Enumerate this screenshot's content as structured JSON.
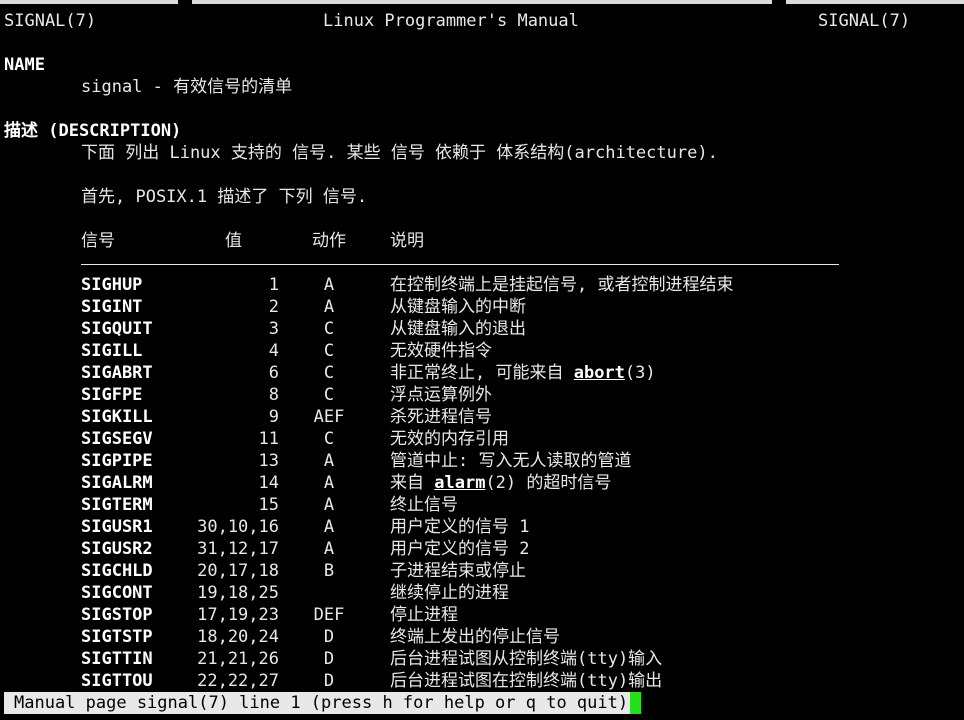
{
  "header": {
    "left": "SIGNAL(7)",
    "center": "Linux Programmer's Manual",
    "right": "SIGNAL(7)"
  },
  "name_section": {
    "heading": "NAME",
    "text": "signal - 有效信号的清单"
  },
  "description_section": {
    "heading": "描述 (DESCRIPTION)",
    "para1": "下面 列出 Linux 支持的 信号. 某些 信号 依赖于 体系结构(architecture).",
    "para2": "首先, POSIX.1 描述了 下列 信号."
  },
  "table": {
    "headers": [
      "信号",
      "值",
      "动作",
      "说明"
    ],
    "rows": [
      {
        "signal": "SIGHUP",
        "value": "1",
        "action": "A",
        "desc": "在控制终端上是挂起信号, 或者控制进程结束"
      },
      {
        "signal": "SIGINT",
        "value": "2",
        "action": "A",
        "desc": "从键盘输入的中断"
      },
      {
        "signal": "SIGQUIT",
        "value": "3",
        "action": "C",
        "desc": "从键盘输入的退出"
      },
      {
        "signal": "SIGILL",
        "value": "4",
        "action": "C",
        "desc": "无效硬件指令"
      },
      {
        "signal": "SIGABRT",
        "value": "6",
        "action": "C",
        "desc": "非正常终止, 可能来自 ",
        "link": "abort",
        "suffix": "(3)"
      },
      {
        "signal": "SIGFPE",
        "value": "8",
        "action": "C",
        "desc": "浮点运算例外"
      },
      {
        "signal": "SIGKILL",
        "value": "9",
        "action": "AEF",
        "desc": "杀死进程信号"
      },
      {
        "signal": "SIGSEGV",
        "value": "11",
        "action": "C",
        "desc": "无效的内存引用"
      },
      {
        "signal": "SIGPIPE",
        "value": "13",
        "action": "A",
        "desc": "管道中止: 写入无人读取的管道"
      },
      {
        "signal": "SIGALRM",
        "value": "14",
        "action": "A",
        "desc": "来自 ",
        "link": "alarm",
        "suffix": "(2) 的超时信号"
      },
      {
        "signal": "SIGTERM",
        "value": "15",
        "action": "A",
        "desc": "终止信号"
      },
      {
        "signal": "SIGUSR1",
        "value": "30,10,16",
        "action": "A",
        "desc": "用户定义的信号 1"
      },
      {
        "signal": "SIGUSR2",
        "value": "31,12,17",
        "action": "A",
        "desc": "用户定义的信号 2"
      },
      {
        "signal": "SIGCHLD",
        "value": "20,17,18",
        "action": "B",
        "desc": "子进程结束或停止"
      },
      {
        "signal": "SIGCONT",
        "value": "19,18,25",
        "action": "",
        "desc": "继续停止的进程"
      },
      {
        "signal": "SIGSTOP",
        "value": "17,19,23",
        "action": "DEF",
        "desc": "停止进程"
      },
      {
        "signal": "SIGTSTP",
        "value": "18,20,24",
        "action": "D",
        "desc": "终端上发出的停止信号"
      },
      {
        "signal": "SIGTTIN",
        "value": "21,21,26",
        "action": "D",
        "desc": "后台进程试图从控制终端(tty)输入"
      },
      {
        "signal": "SIGTTOU",
        "value": "22,22,27",
        "action": "D",
        "desc": "后台进程试图在控制终端(tty)输出"
      }
    ]
  },
  "status_bar": {
    "text": "Manual page signal(7) line 1 (press h for help or q to quit)"
  },
  "colors": {
    "background": "#000000",
    "foreground": "#e8e8e8",
    "cursor": "#22e01a"
  }
}
